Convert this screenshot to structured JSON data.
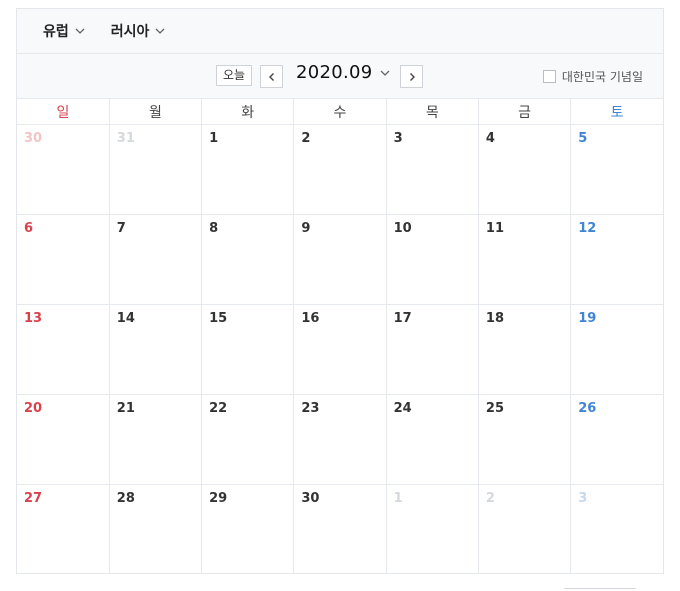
{
  "region": {
    "label": "유럽"
  },
  "country": {
    "label": "러시아"
  },
  "nav": {
    "today_label": "오늘",
    "month_label": "2020.09",
    "holiday_label": "대한민국 기념일"
  },
  "weekdays": [
    "일",
    "월",
    "화",
    "수",
    "목",
    "금",
    "토"
  ],
  "weeks": [
    [
      "30",
      "31",
      "1",
      "2",
      "3",
      "4",
      "5"
    ],
    [
      "6",
      "7",
      "8",
      "9",
      "10",
      "11",
      "12"
    ],
    [
      "13",
      "14",
      "15",
      "16",
      "17",
      "18",
      "19"
    ],
    [
      "20",
      "21",
      "22",
      "23",
      "24",
      "25",
      "26"
    ],
    [
      "27",
      "28",
      "29",
      "30",
      "1",
      "2",
      "3"
    ]
  ],
  "outside_days": {
    "week0": [
      0,
      1
    ],
    "week4": [
      4,
      5,
      6
    ]
  },
  "colors": {
    "sunday": "#d9414b",
    "saturday": "#3f84d6"
  }
}
